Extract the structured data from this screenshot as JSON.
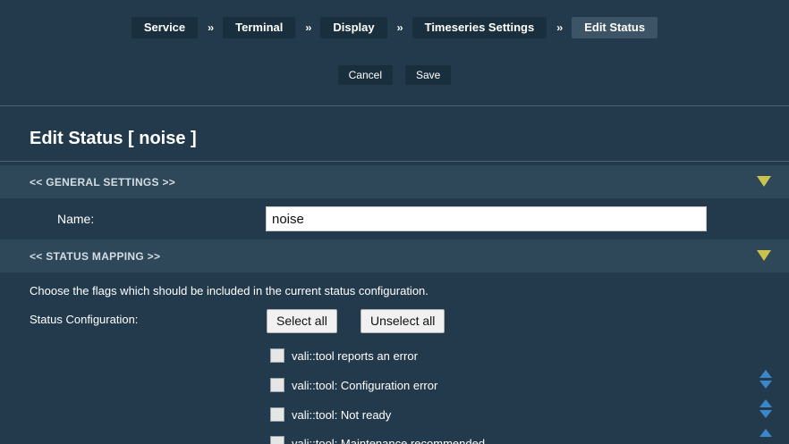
{
  "breadcrumbs": [
    {
      "label": "Service"
    },
    {
      "label": "Terminal"
    },
    {
      "label": "Display"
    },
    {
      "label": "Timeseries Settings"
    },
    {
      "label": "Edit Status"
    }
  ],
  "breadcrumb_separator": "››",
  "actions": {
    "cancel": "Cancel",
    "save": "Save"
  },
  "page_title": "Edit Status [ noise ]",
  "general_settings": {
    "title": "<<  GENERAL SETTINGS  >>",
    "name_label": "Name:",
    "name_value": "noise"
  },
  "status_mapping": {
    "title": "<<  STATUS MAPPING  >>",
    "description": "Choose the flags which should be included in the current status configuration.",
    "config_label": "Status Configuration:",
    "select_all": "Select all",
    "unselect_all": "Unselect all",
    "flags": [
      {
        "label": "vali::tool reports an error",
        "checked": false
      },
      {
        "label": "vali::tool: Configuration error",
        "checked": false
      },
      {
        "label": "vali::tool: Not ready",
        "checked": false
      },
      {
        "label": "vali::tool: Maintenance recommended",
        "checked": false
      }
    ]
  },
  "colors": {
    "background": "#223a4c",
    "section_header": "#2e4759",
    "collapse_triangle": "#c9c24d",
    "reorder_arrows": "#3a86c7"
  }
}
